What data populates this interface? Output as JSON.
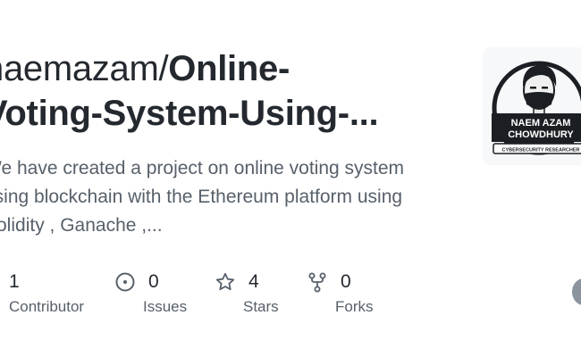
{
  "repo": {
    "owner": "naemazam/",
    "name_line1": "Online-",
    "name_line2": "Voting-System-Using-..."
  },
  "description": {
    "line1": "We have created a project on online voting system",
    "line2": "using blockchain with the Ethereum platform using",
    "line3": "Solidity , Ganache ,..."
  },
  "avatar": {
    "name_line1": "NAEM AZAM",
    "name_line2": "CHOWDHURY",
    "role": "CYBERSECURITY RESEARCHER"
  },
  "stats": {
    "contributors": {
      "count": "1",
      "label": "Contributor",
      "icon": "people-icon"
    },
    "issues": {
      "count": "0",
      "label": "Issues",
      "icon": "issue-opened-icon"
    },
    "stars": {
      "count": "4",
      "label": "Stars",
      "icon": "star-icon"
    },
    "forks": {
      "count": "0",
      "label": "Forks",
      "icon": "repo-forked-icon"
    }
  },
  "colors": {
    "text_primary": "#24292f",
    "text_secondary": "#57606a",
    "icon": "#57606a"
  }
}
